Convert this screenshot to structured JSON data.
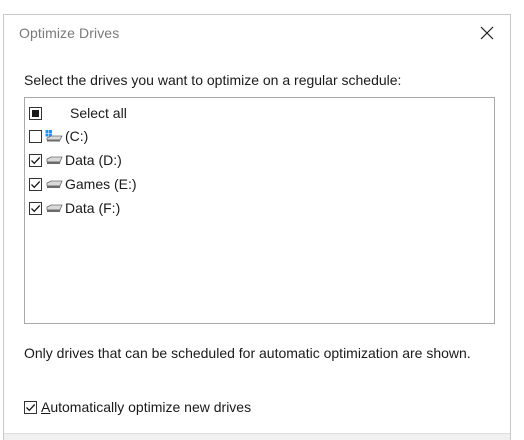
{
  "window": {
    "title": "Optimize Drives"
  },
  "instruction": "Select the drives you want to optimize on a regular schedule:",
  "select_all": {
    "label": "Select all",
    "state": "indeterminate"
  },
  "drives": [
    {
      "label": "(C:)",
      "checked": false,
      "icon": "system-drive-icon"
    },
    {
      "label": "Data (D:)",
      "checked": true,
      "icon": "drive-icon"
    },
    {
      "label": "Games (E:)",
      "checked": true,
      "icon": "drive-icon"
    },
    {
      "label": "Data (F:)",
      "checked": true,
      "icon": "drive-icon"
    }
  ],
  "note": "Only drives that can be scheduled for automatic optimization are shown.",
  "auto_optimize": {
    "label_first": "A",
    "label_rest": "utomatically optimize new drives",
    "checked": true
  },
  "colors": {
    "windows_logo": "#1e90ff",
    "drive_gray": "#6b6b6b"
  }
}
